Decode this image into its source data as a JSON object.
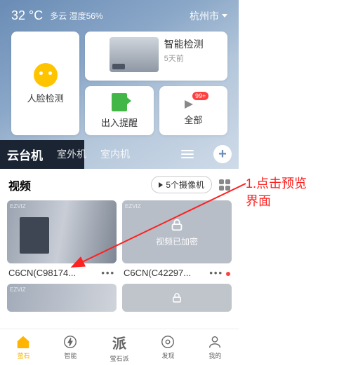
{
  "header": {
    "temp": "32 °C",
    "weather": "多云 湿度56%",
    "location": "杭州市"
  },
  "cards": {
    "face_detect": "人脸检测",
    "smart_detect": {
      "title": "智能检测",
      "sub": "5天前"
    },
    "door": "出入提醒",
    "all": "全部",
    "badge": "99+"
  },
  "tabs": {
    "active": "云台机",
    "t2": "室外机",
    "t3": "室内机"
  },
  "videos": {
    "title": "视频",
    "cam_count": "5个摄像机",
    "encrypted_label": "视频已加密",
    "items": [
      {
        "name": "C6CN(C98174..."
      },
      {
        "name": "C6CN(C42297..."
      }
    ]
  },
  "nav": {
    "t1": "萤石",
    "t2": "智能",
    "t3": "萤石派",
    "t4": "发现",
    "t5": "我的"
  },
  "annotation": {
    "line1": "1.点击预览",
    "line2": "界面"
  }
}
